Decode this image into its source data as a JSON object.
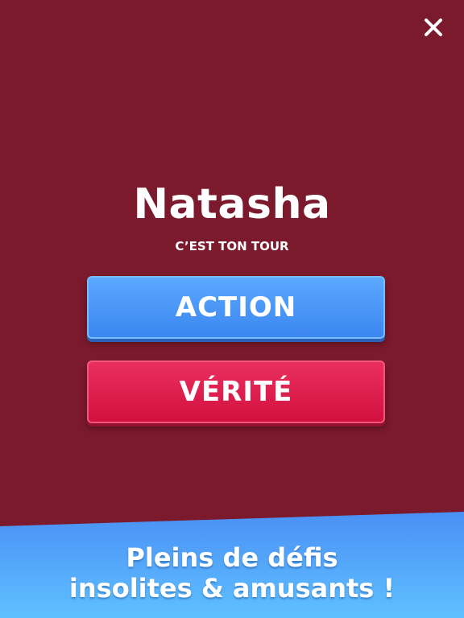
{
  "header": {
    "close_icon": "close-icon"
  },
  "player": {
    "name": "Natasha",
    "turn_label": "C’EST TON TOUR"
  },
  "buttons": {
    "action_label": "ACTION",
    "truth_label": "VÉRITÉ"
  },
  "promo": {
    "line1": "Pleins de défis",
    "line2": "insolites & amusants !"
  },
  "colors": {
    "background": "#7b1a2c",
    "action_button": "#4296f8",
    "truth_button": "#de1f4e",
    "promo_banner": "#56a8fb"
  }
}
